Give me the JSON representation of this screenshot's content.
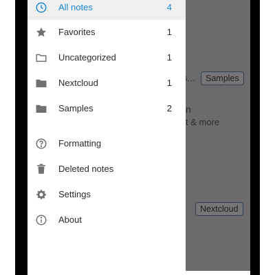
{
  "drawer": {
    "categories": [
      {
        "label": "All notes",
        "count": "4",
        "icon": "clock-icon",
        "active": true
      },
      {
        "label": "Favorites",
        "count": "1",
        "icon": "star-icon"
      },
      {
        "label": "Uncategorized",
        "count": "1",
        "icon": "folder-outline-icon"
      },
      {
        "label": "Nextcloud",
        "count": "1",
        "icon": "folder-icon"
      },
      {
        "label": "Samples",
        "count": "2",
        "icon": "folder-icon"
      }
    ],
    "actions": [
      {
        "label": "Formatting",
        "icon": "help-circle-icon"
      },
      {
        "label": "Deleted notes",
        "icon": "trash-icon"
      },
      {
        "label": "Settings",
        "icon": "gear-icon"
      },
      {
        "label": "About",
        "icon": "info-icon"
      }
    ]
  },
  "background": {
    "snippet_1": "s...",
    "chip_1": "Samples",
    "snippet_2": "n",
    "snippet_3": "t & more",
    "chip_2": "Nextcloud"
  },
  "colors": {
    "accent": "#1e87d8",
    "scrim": "#6b6b6b",
    "active_row": "#efefef"
  }
}
